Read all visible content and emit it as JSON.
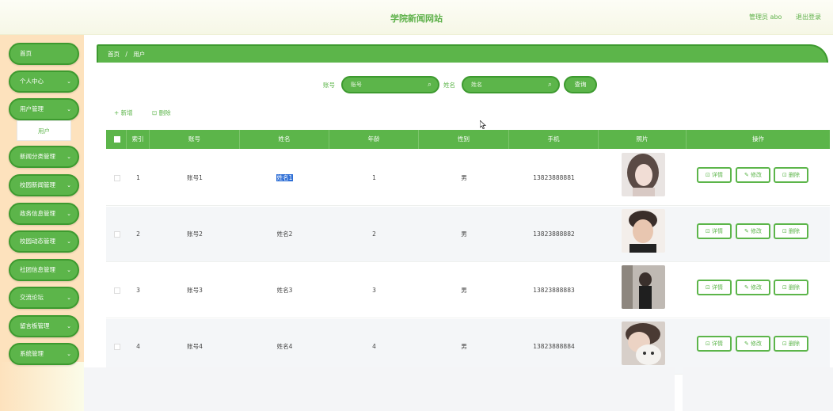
{
  "header": {
    "title": "学院新闻网站",
    "admin": "管理员 abo",
    "logout": "退出登录"
  },
  "sidebar": {
    "items": [
      {
        "label": "首页",
        "chevron": false
      },
      {
        "label": "个人中心",
        "chevron": true
      },
      {
        "label": "用户管理",
        "chevron": true
      },
      {
        "label": "新闻分类管理",
        "chevron": true
      },
      {
        "label": "校园新闻管理",
        "chevron": true
      },
      {
        "label": "政务信息管理",
        "chevron": true
      },
      {
        "label": "校园动态管理",
        "chevron": true
      },
      {
        "label": "社团信息管理",
        "chevron": true
      },
      {
        "label": "交流论坛",
        "chevron": true
      },
      {
        "label": "留言板管理",
        "chevron": true
      },
      {
        "label": "系统管理",
        "chevron": true
      }
    ],
    "subitem": "用户"
  },
  "breadcrumb": {
    "home": "首页",
    "sep": "/",
    "current": "用户"
  },
  "search": {
    "account_label": "账号",
    "account_placeholder": "账号",
    "name_label": "姓名",
    "name_placeholder": "姓名",
    "query_button": "查询"
  },
  "actions": {
    "add": "新增",
    "delete": "删除"
  },
  "table": {
    "columns": [
      "索引",
      "账号",
      "姓名",
      "年龄",
      "性别",
      "手机",
      "照片",
      "操作"
    ],
    "rows": [
      {
        "index": "1",
        "account": "账号1",
        "name": "姓名1",
        "age": "1",
        "gender": "男",
        "phone": "13823888881"
      },
      {
        "index": "2",
        "account": "账号2",
        "name": "姓名2",
        "age": "2",
        "gender": "男",
        "phone": "13823888882"
      },
      {
        "index": "3",
        "account": "账号3",
        "name": "姓名3",
        "age": "3",
        "gender": "男",
        "phone": "13823888883"
      },
      {
        "index": "4",
        "account": "账号4",
        "name": "姓名4",
        "age": "4",
        "gender": "男",
        "phone": "13823888884"
      }
    ],
    "op": {
      "detail": "详情",
      "edit": "修改",
      "delete": "删除"
    }
  },
  "icons": {
    "search": "search-icon",
    "chevron": "chevron-down-icon",
    "plus": "plus-icon",
    "trash": "trash-icon"
  },
  "colors": {
    "accent": "#5cb54a",
    "accent_dark": "#3d9a2f",
    "sidebar_bg": "#fde2bd"
  }
}
